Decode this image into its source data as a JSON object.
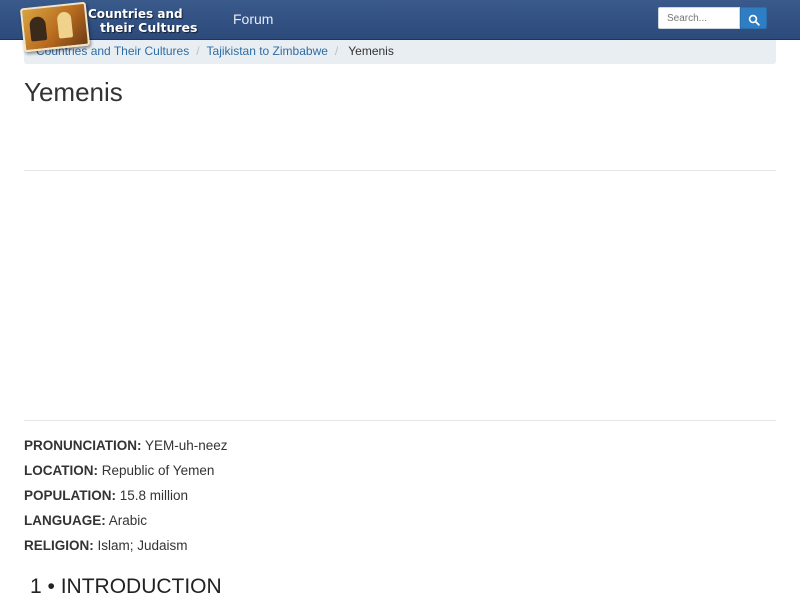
{
  "header": {
    "logo_line1": "Countries and",
    "logo_line2": "their Cultures",
    "forum_label": "Forum",
    "search": {
      "placeholder": "Search...",
      "value": ""
    },
    "icons": {
      "search": "magnifier-icon"
    },
    "colors": {
      "navbar": "#2c4a7a",
      "search_button": "#2f7ec4"
    }
  },
  "breadcrumb": {
    "items": [
      "Countries and Their Cultures",
      "Tajikistan to Zimbabwe"
    ],
    "current": "Yemenis",
    "separator": "/"
  },
  "page": {
    "title": "Yemenis"
  },
  "facts": [
    {
      "key": "PRONUNCIATION:",
      "value": "YEM-uh-neez"
    },
    {
      "key": "LOCATION:",
      "value": "Republic of Yemen"
    },
    {
      "key": "POPULATION:",
      "value": "15.8 million"
    },
    {
      "key": "LANGUAGE:",
      "value": "Arabic"
    },
    {
      "key": "RELIGION:",
      "value": "Islam; Judaism"
    }
  ],
  "section": {
    "heading": "1 • INTRODUCTION"
  }
}
